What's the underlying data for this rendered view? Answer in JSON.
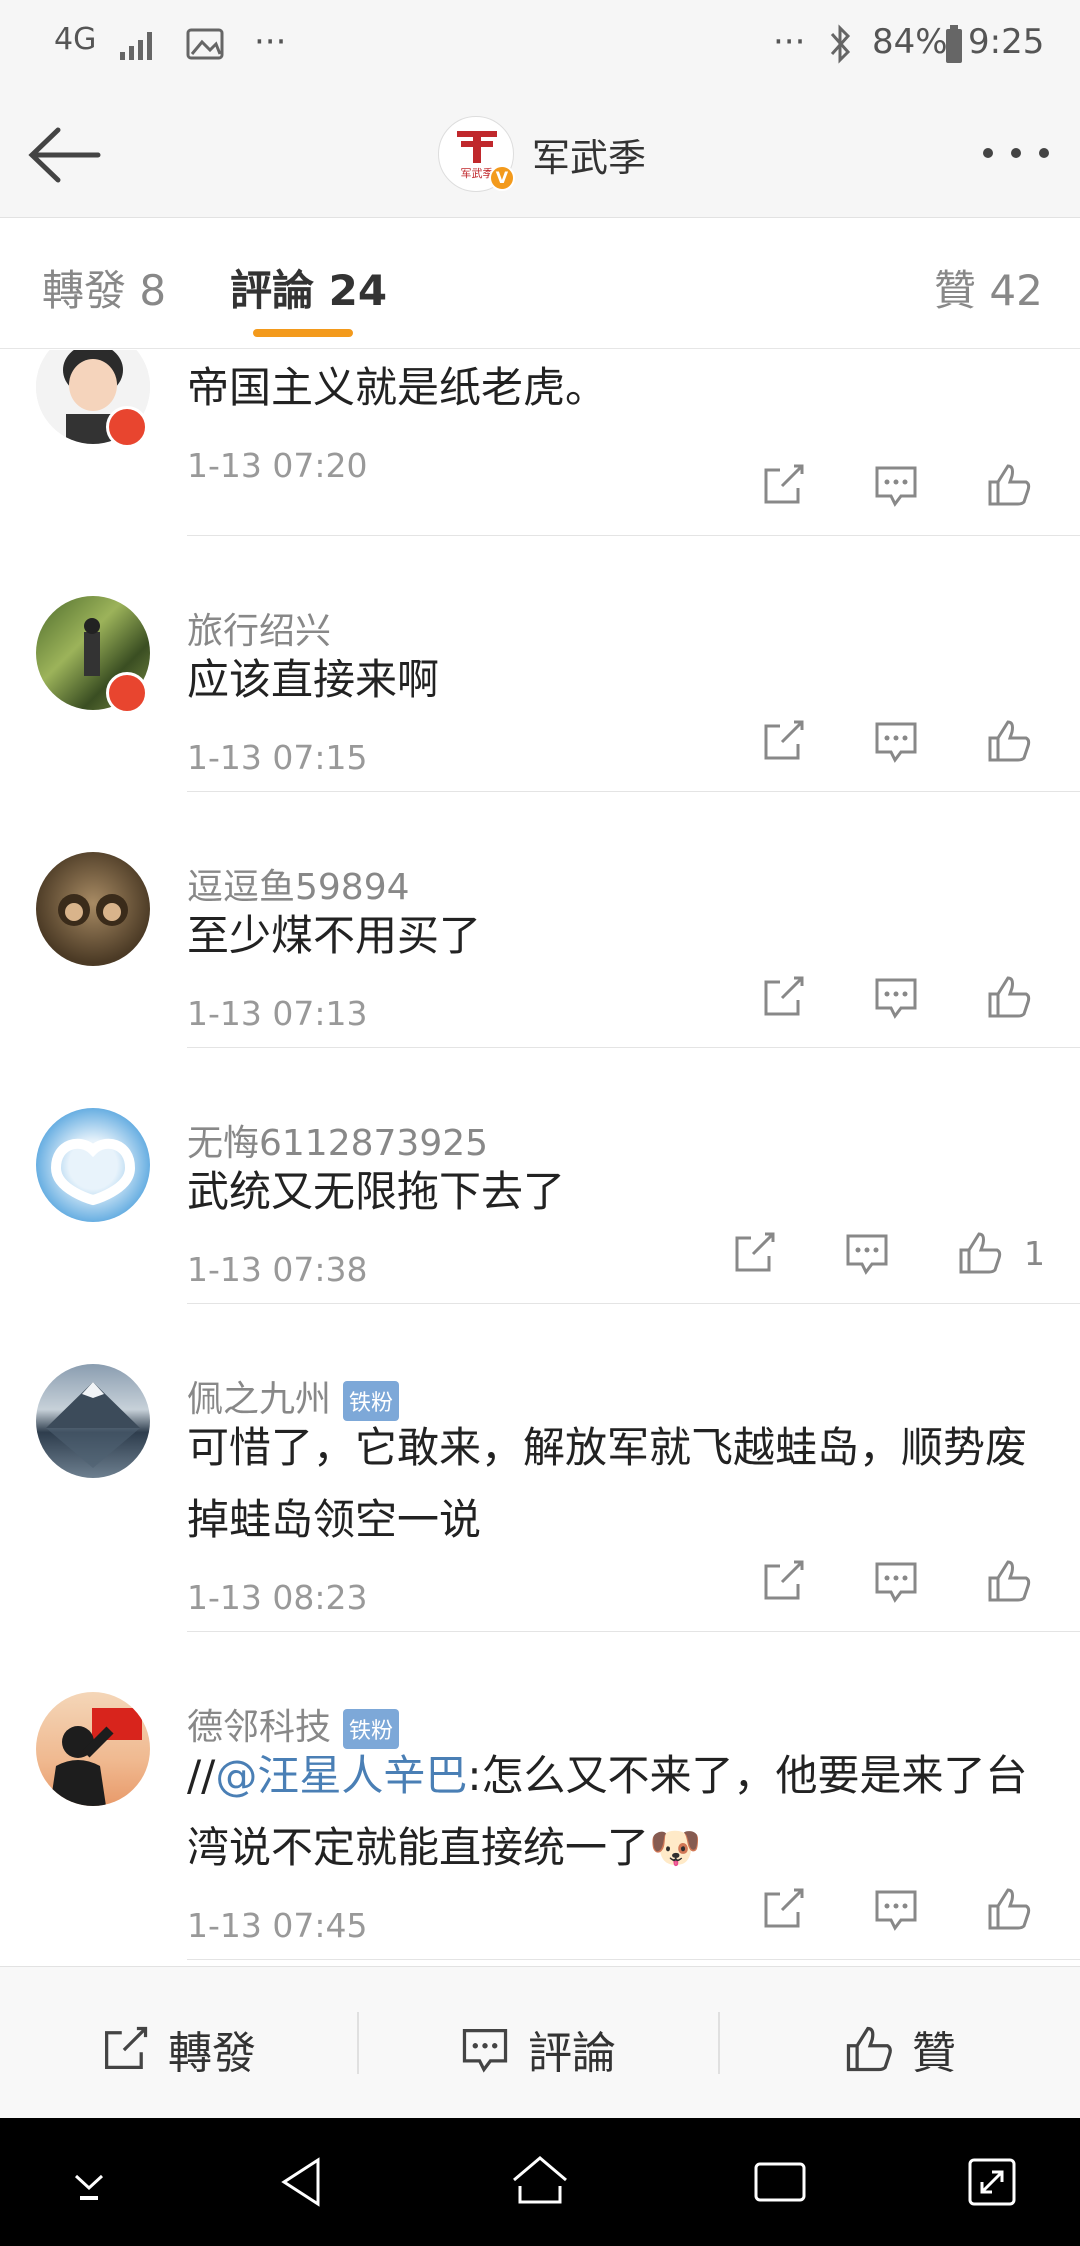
{
  "status_bar": {
    "network": "4G",
    "signal_icon": "signal-icon",
    "image_icon": "image-icon",
    "more_dots": "···",
    "right_dots": "···",
    "bluetooth_icon": "bluetooth-icon",
    "battery": "84%",
    "time": "9:25"
  },
  "nav": {
    "title": "军武季",
    "avatar_text": "军武季",
    "back_icon": "back-arrow-icon",
    "more_icon": "more-dots-icon"
  },
  "tabs": [
    {
      "label": "轉發 8"
    },
    {
      "label": "評論 24"
    },
    {
      "label": "贊 42"
    }
  ],
  "comments": [
    {
      "username": "",
      "text": "帝国主义就是纸老虎。",
      "time": "1-13 07:20",
      "likes": ""
    },
    {
      "username": "旅行绍兴",
      "text": "应该直接来啊",
      "time": "1-13 07:15",
      "likes": ""
    },
    {
      "username": "逗逗鱼59894",
      "text": "至少煤不用买了",
      "time": "1-13 07:13",
      "likes": ""
    },
    {
      "username": "无悔6112873925",
      "text": "武统又无限拖下去了",
      "time": "1-13 07:38",
      "likes": "1"
    },
    {
      "username": "佩之九州",
      "fan_badge": "铁粉",
      "text": "可惜了，它敢来，解放军就飞越蛙岛，顺势废掉蛙岛领空一说",
      "time": "1-13 08:23",
      "likes": ""
    },
    {
      "username": "德邻科技",
      "fan_badge": "铁粉",
      "text_prefix": "//",
      "mention": "@汪星人辛巴",
      "text": ":怎么又不来了，他要是来了台湾说不定就能直接统一了",
      "emoji": "🐶",
      "time": "1-13 07:45",
      "likes": ""
    }
  ],
  "bottom_bar": {
    "repost": "轉發",
    "comment": "評論",
    "like": "贊"
  },
  "colors": {
    "accent": "#f39a1c",
    "mention": "#4a7fb5",
    "fan_badge": "#7da8d8",
    "verify_badge": "#e8452f"
  }
}
